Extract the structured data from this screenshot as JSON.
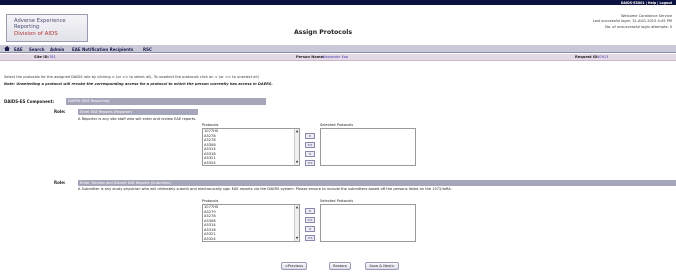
{
  "toplinks": "DAIDS-ES001 | Help | Logout",
  "logo": {
    "line1": "Adverse Experience",
    "line2": "Reporting",
    "line3": "Division of AIDS"
  },
  "page_title": "Assign Protocols",
  "welcome": {
    "line1": "Welcome Constance Service",
    "line2": "Last successful login: 31-AUG-2015 4:45 PM",
    "line3": "No. of unsuccessful login attempts: 0"
  },
  "nav": {
    "items": [
      "EAE",
      "Search",
      "Admin",
      "EAE Notification Recipients",
      "RSC"
    ]
  },
  "info": {
    "site_id_label": "Site ID:",
    "site_id_value": "781",
    "person_name_label": "Person Name:",
    "person_name_value": "Alexander Xao",
    "request_id_label": "Request ID:",
    "request_id_value": "10913"
  },
  "instructions": "Select the protocols for the assigned DAIDS role by clicking > (or >> to select all). To unselect the protocols click on < (or << to unselect all)",
  "note": "Note: Unselecting a protocol will revoke the corresponding access for a protocol to which the person currently has access in DAERS.",
  "component": {
    "label": "DAIDS-ES Component:",
    "value": "DAERS (EAE Reporting)"
  },
  "roles": [
    {
      "label": "Role:",
      "name": "Enter EAE Reports (Reporter)",
      "desc": "A Reporter is any site staff who will enter and review EAE reports.",
      "protocols_header": "Protocols",
      "selected_header": "Selected Protocols",
      "protocols": [
        "1077HS",
        "A5278",
        "A5278",
        "A5308",
        "A5314",
        "A5318",
        "A5321",
        "A5324"
      ]
    },
    {
      "label": "Role:",
      "name": "Enter, Review and Submit EAE Reports (Submitter)",
      "desc": "A Submitter is any study physician who will ultimately submit and electronically sign EAE reports via the DAERS system. Please ensure to include the submitters based off the persons listed on the 1572/IoRA.",
      "protocols_header": "Protocols",
      "selected_header": "Selected Protocols",
      "protocols": [
        "1077HS",
        "A5279",
        "A5278",
        "A5308",
        "A5314",
        "A5318",
        "A5321",
        "A5324"
      ]
    }
  ],
  "move_buttons": [
    ">",
    ">>",
    "<",
    "<<"
  ],
  "footer": {
    "previous": "<Previous",
    "restore": "Restore",
    "save_next": "Save & Next>"
  },
  "colors": {
    "topbar": "#0b1140",
    "navbar": "#c9c9d8",
    "infobar": "#e6d9e6",
    "section_bar": "#a6a6bb",
    "logo_red": "#b03030"
  }
}
